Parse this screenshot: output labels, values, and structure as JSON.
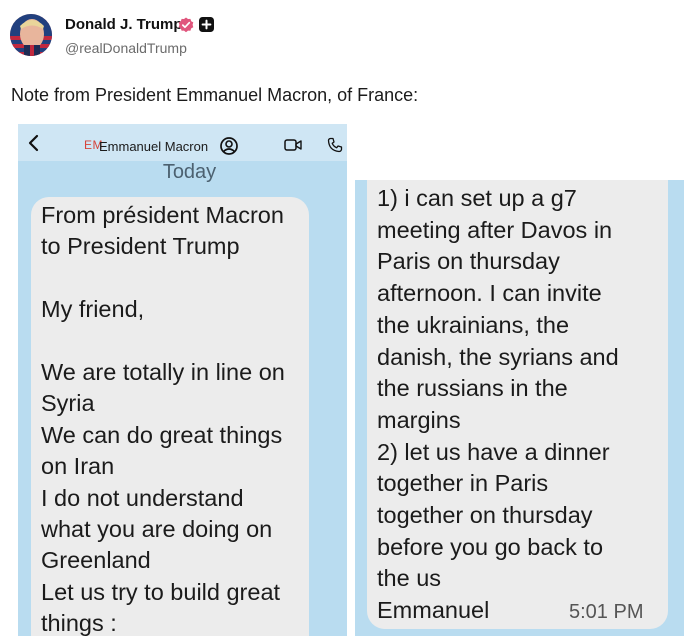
{
  "post": {
    "author_name": "Donald J. Trump",
    "handle": "@realDonaldTrump",
    "text": "Note from President Emmanuel Macron, of France:",
    "icons": {
      "avatar": "user-avatar",
      "verified": "verified-badge-icon",
      "plus": "plus-badge-icon"
    },
    "colors": {
      "verified": "#e0567d",
      "handle": "#6b6b6b"
    }
  },
  "screenshot_1": {
    "contact_initials": "EM",
    "contact_name": "Emmanuel Macron",
    "day_label": "Today",
    "message": "From président Macron\nto President Trump\n\nMy friend,\n\nWe are totally in line on\nSyria\nWe can do great things\non Iran\nI do not understand\nwhat you are doing on\nGreenland\nLet us try to build great\nthings :",
    "icons": [
      "back-icon",
      "contact-icon",
      "video-call-icon",
      "phone-icon"
    ],
    "colors": {
      "background": "#b9dcf0",
      "bubble": "#ececec",
      "initials": "#d6443b"
    }
  },
  "screenshot_2": {
    "message": "1) i can set up a g7\nmeeting after Davos in\nParis on thursday\nafternoon. I can invite\nthe ukrainians, the\ndanish, the syrians and\nthe russians in the\nmargins\n2) let us have a dinner\ntogether in Paris\ntogether on thursday\nbefore you go back to\nthe us\nEmmanuel",
    "timestamp": "5:01 PM"
  }
}
